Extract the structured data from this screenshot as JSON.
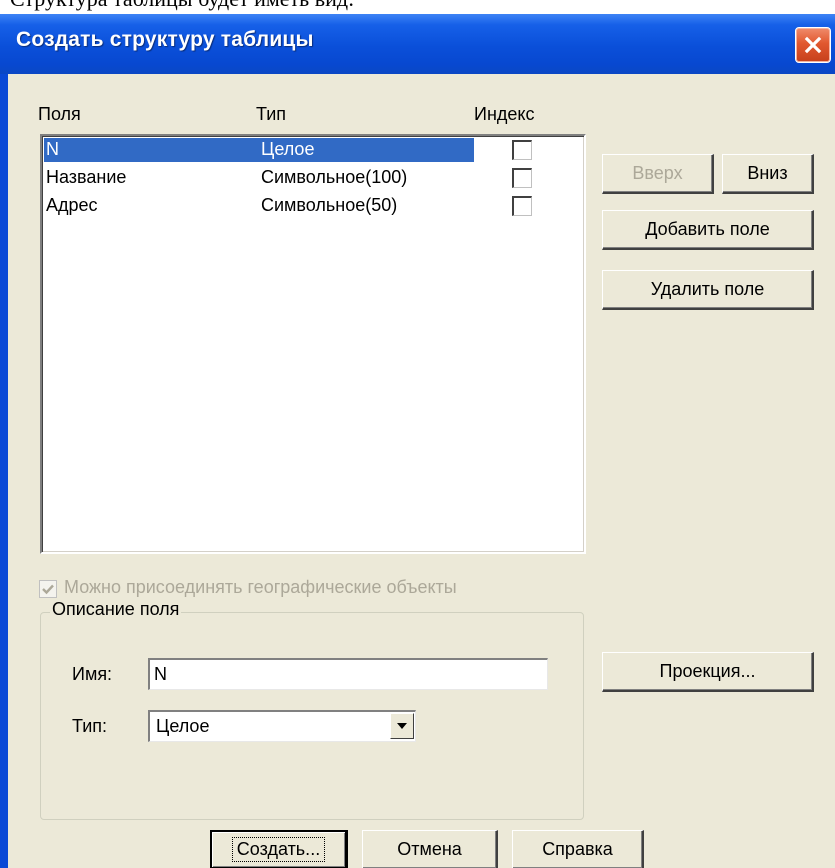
{
  "document": {
    "visible_text": "Структура таблицы будет иметь вид:"
  },
  "window": {
    "title": "Создать структуру таблицы"
  },
  "fields_list": {
    "headers": {
      "name": "Поля",
      "type": "Тип",
      "index": "Индекс"
    },
    "rows": [
      {
        "name": "N",
        "type": "Целое",
        "index": false,
        "selected": true
      },
      {
        "name": "Название",
        "type": "Символьное(100)",
        "index": false,
        "selected": false
      },
      {
        "name": "Адрес",
        "type": "Символьное(50)",
        "index": false,
        "selected": false
      }
    ]
  },
  "buttons": {
    "up": "Вверх",
    "down": "Вниз",
    "add_field": "Добавить поле",
    "delete_field": "Удалить поле",
    "projection": "Проекция...",
    "create": "Создать...",
    "cancel": "Отмена",
    "help": "Справка"
  },
  "geo_objects": {
    "label": "Можно присоединять географические объекты",
    "checked": true,
    "enabled": false
  },
  "field_description": {
    "group_label": "Описание поля",
    "name_label": "Имя:",
    "name_value": "N",
    "type_label": "Тип:",
    "type_value": "Целое"
  },
  "colors": {
    "title_bar": "#0a4fd9",
    "dialog_face": "#ece9d8",
    "selection": "#316ac5",
    "close_button": "#e1582f",
    "disabled_text": "#aca899"
  },
  "icons": {
    "close": "close-x-icon",
    "check": "checkmark-icon",
    "dropdown": "chevron-down-icon"
  }
}
